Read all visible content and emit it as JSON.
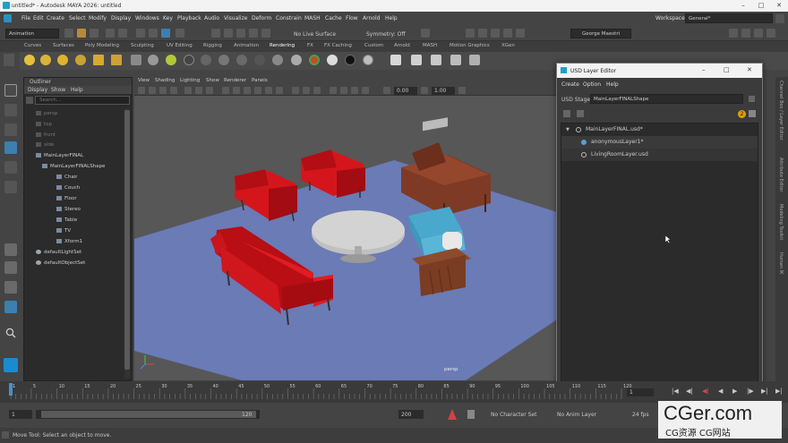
{
  "window": {
    "title": "untitled* - Autodesk MAYA 2026: untitled",
    "min": "–",
    "max": "□",
    "close": "✕"
  },
  "menubar": {
    "items": [
      "File",
      "Edit",
      "Create",
      "Select",
      "Modify",
      "Display",
      "Windows",
      "Key",
      "Playback",
      "Audio",
      "Visualize",
      "Deform",
      "Constrain",
      "MASH",
      "Cache",
      "Flow",
      "Arnold",
      "Help"
    ],
    "workspace_label": "Workspace :",
    "workspace_value": "General*"
  },
  "statusline": {
    "mode": "Animation",
    "live_surface": "No Live Surface",
    "symmetry": "Symmetry: Off",
    "user": "George Maestri"
  },
  "shelf_tabs": [
    "Curves",
    "Surfaces",
    "Poly Modeling",
    "Sculpting",
    "UV Editing",
    "Rigging",
    "Animation",
    "Rendering",
    "FX",
    "FX Caching",
    "Custom",
    "Arnold",
    "MASH",
    "Motion Graphics",
    "XGen"
  ],
  "shelf_active": "Rendering",
  "outliner": {
    "title": "Outliner",
    "menu": [
      "Display",
      "Show",
      "Help"
    ],
    "search_placeholder": "Search...",
    "items": [
      {
        "label": "persp",
        "dim": true
      },
      {
        "label": "top",
        "dim": true
      },
      {
        "label": "front",
        "dim": true
      },
      {
        "label": "side",
        "dim": true
      },
      {
        "label": "MainLayerFINAL",
        "dim": false
      },
      {
        "label": "MainLayerFINALShape",
        "dim": false
      },
      {
        "label": "Chair",
        "dim": false
      },
      {
        "label": "Couch",
        "dim": false
      },
      {
        "label": "Floor",
        "dim": false
      },
      {
        "label": "Stereo",
        "dim": false
      },
      {
        "label": "Table",
        "dim": false
      },
      {
        "label": "TV",
        "dim": false
      },
      {
        "label": "Xform1",
        "dim": false
      },
      {
        "label": "defaultLightSet",
        "dim": false
      },
      {
        "label": "defaultObjectSet",
        "dim": false
      }
    ]
  },
  "viewport": {
    "menu": [
      "View",
      "Shading",
      "Lighting",
      "Show",
      "Renderer",
      "Panels"
    ],
    "value_a": "0.00",
    "value_b": "1.00",
    "camera_label": "persp"
  },
  "usd_editor": {
    "title": "USD Layer Editor",
    "menu": [
      "Create",
      "Option",
      "Help"
    ],
    "stage_label": "USD Stage:",
    "stage_value": "MainLayerFINALShape",
    "badge_count": "2",
    "layers": [
      {
        "label": "MainLayerFINAL.usd*"
      },
      {
        "label": "anonymousLayer1*"
      },
      {
        "label": "LivingRoomLayer.usd"
      }
    ]
  },
  "side_tabs": [
    "Channel Box / Layer Editor",
    "Attribute Editor",
    "Modeling Toolkit",
    "Human IK"
  ],
  "timeline": {
    "ticks": [
      "1",
      "5",
      "10",
      "15",
      "20",
      "25",
      "30",
      "35",
      "40",
      "45",
      "50",
      "55",
      "60",
      "65",
      "70",
      "75",
      "80",
      "85",
      "90",
      "95",
      "100",
      "105",
      "110",
      "115",
      "120"
    ],
    "current_frame": "1"
  },
  "range": {
    "start": "1",
    "inner_start": "1",
    "inner_end": "120",
    "end": "200",
    "character_set": "No Character Set",
    "anim_layer": "No Anim Layer",
    "fps": "24 fps"
  },
  "helpline": {
    "text": "Move Tool: Select an object to move."
  },
  "watermark": {
    "line1": "CGer.com",
    "line2": "CG资源 CG网站"
  }
}
